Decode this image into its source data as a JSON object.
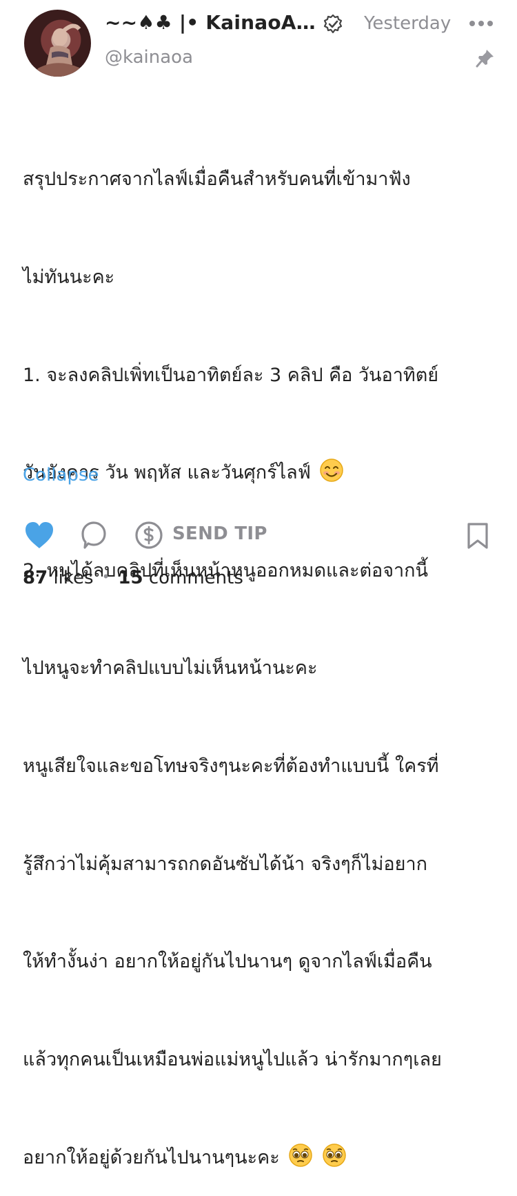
{
  "post": {
    "display_name": "~~♠♣ |• KainaoA…",
    "handle": "@kainaoa",
    "timestamp": "Yesterday",
    "body_lines": [
      "สรุปประกาศจากไลฟ์เมื่อคืนสำหรับคนที่เข้ามาฟัง",
      "ไม่ทันนะคะ",
      "1. จะลงคลิปเพิ่ทเป็นอาทิตย์ละ 3 คลิป คือ วันอาทิตย์",
      "วันอังคาร วัน พฤหัส และวันศุกร์ไลฟ์",
      "2. หนูได้ลบคลิปที่เห็นหน้าหนูออกหมดและต่อจากนี้",
      "ไปหนูจะทำคลิปแบบไม่เห็นหน้านะคะ",
      "หนูเสียใจและขอโทษจริงๆนะคะที่ต้องทำแบบนี้ ใครที่",
      "รู้สึกว่าไม่คุ้มสามารถกดอันซับได้น้า จริงๆก็ไม่อยาก",
      "ให้ทำงั้นง่า อยากให้อยู่กันไปนานๆ ดูจากไลฟ์เมื่อคืน",
      "แล้วทุกคนเป็นเหมือนพ่อแม่หนูไปแล้ว น่ารักมากๆเลย",
      "อยากให้อยู่ด้วยกันไปนานๆนะคะ"
    ],
    "collapse_label": "Collapse"
  },
  "actions": {
    "tip_label": "SEND TIP"
  },
  "stats": {
    "likes_count": "87",
    "likes_label": "likes",
    "comments_count": "15",
    "comments_label": "comments"
  },
  "icons": {
    "verified": "verified-check-icon",
    "more": "more-dots-icon",
    "pin": "pin-icon",
    "heart": "heart-icon",
    "comment": "comment-bubble-icon",
    "tip": "dollar-coin-icon",
    "bookmark": "bookmark-icon",
    "emoji_smile": "smiling-face-emoji",
    "emoji_pleading": "pleading-face-emoji"
  },
  "colors": {
    "accent_blue": "#4aa3e6",
    "muted_gray": "#8e8e93",
    "text": "#222222"
  }
}
